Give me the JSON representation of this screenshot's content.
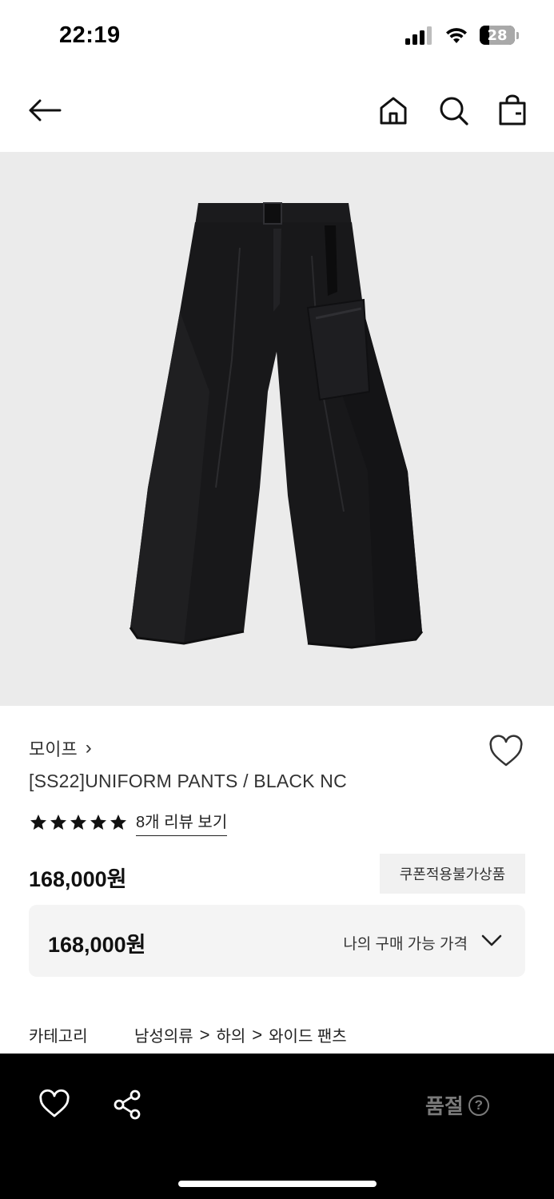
{
  "status_bar": {
    "time": "22:19",
    "battery_level": "28",
    "icons": [
      "cellular-signal-icon",
      "wifi-icon",
      "battery-icon"
    ]
  },
  "top_nav": {
    "icons": [
      "back-arrow-icon",
      "home-icon",
      "search-icon",
      "shopping-bag-icon"
    ]
  },
  "product": {
    "image_subject": "black wide-leg pants",
    "brand": "모이프",
    "brand_chevron": "›",
    "name": "[SS22]UNIFORM PANTS / BLACK NC",
    "rating_stars": 5,
    "review_link": "8개 리뷰 보기",
    "price": "168,000원",
    "coupon_badge": "쿠폰적용불가상품"
  },
  "price_box": {
    "value": "168,000원",
    "label": "나의 구매 가능 가격"
  },
  "category": {
    "label": "카테고리",
    "path": [
      "남성의류",
      "하의",
      "와이드 팬츠"
    ],
    "separator": ">"
  },
  "bottom_bar": {
    "soldout_label": "품절",
    "help_symbol": "?"
  },
  "colors": {
    "image_background": "#ebebeb",
    "bottom_bar": "#000000",
    "soldout_text": "#7a7a7a",
    "coupon_bg": "#f1f1f1",
    "price_box_bg": "#f4f4f4"
  }
}
